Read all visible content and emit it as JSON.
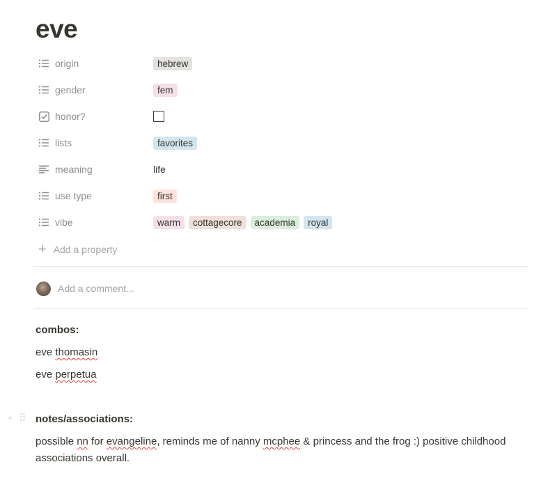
{
  "page": {
    "title": "eve"
  },
  "properties": [
    {
      "name": "origin",
      "icon": "list-icon",
      "type": "tags",
      "tags": [
        {
          "label": "hebrew",
          "color": "#e3e2e0"
        }
      ]
    },
    {
      "name": "gender",
      "icon": "list-icon",
      "type": "tags",
      "tags": [
        {
          "label": "fem",
          "color": "#f5e0e9"
        }
      ]
    },
    {
      "name": "honor?",
      "icon": "checkbox-icon",
      "type": "checkbox",
      "checked": false
    },
    {
      "name": "lists",
      "icon": "list-icon",
      "type": "tags",
      "tags": [
        {
          "label": "favorites",
          "color": "#d3e5ef"
        }
      ]
    },
    {
      "name": "meaning",
      "icon": "text-icon",
      "type": "text",
      "value": "life"
    },
    {
      "name": "use type",
      "icon": "list-icon",
      "type": "tags",
      "tags": [
        {
          "label": "first",
          "color": "#ffe2dd"
        }
      ]
    },
    {
      "name": "vibe",
      "icon": "list-icon",
      "type": "tags",
      "tags": [
        {
          "label": "warm",
          "color": "#f5e0e9"
        },
        {
          "label": "cottagecore",
          "color": "#eee0da"
        },
        {
          "label": "academia",
          "color": "#dbeddb"
        },
        {
          "label": "royal",
          "color": "#d3e5ef"
        }
      ]
    }
  ],
  "add_property": {
    "label": "Add a property",
    "icon": "plus-icon"
  },
  "comment": {
    "placeholder": "Add a comment..."
  },
  "combos": {
    "heading": "combos:",
    "lines": [
      {
        "first": "eve",
        "second": "thomasin"
      },
      {
        "first": "eve",
        "second": "perpetua"
      }
    ]
  },
  "notes": {
    "heading": "notes/associations:",
    "parts": [
      {
        "text": "possible ",
        "sq": false
      },
      {
        "text": "nn",
        "sq": true
      },
      {
        "text": " for ",
        "sq": false
      },
      {
        "text": "evangeline",
        "sq": true
      },
      {
        "text": ", reminds me of nanny ",
        "sq": false
      },
      {
        "text": "mcphee",
        "sq": true
      },
      {
        "text": " & princess and the frog :) positive childhood associations overall.",
        "sq": false
      }
    ]
  },
  "block_handle": {
    "plus": "+",
    "drag": "⠿"
  }
}
